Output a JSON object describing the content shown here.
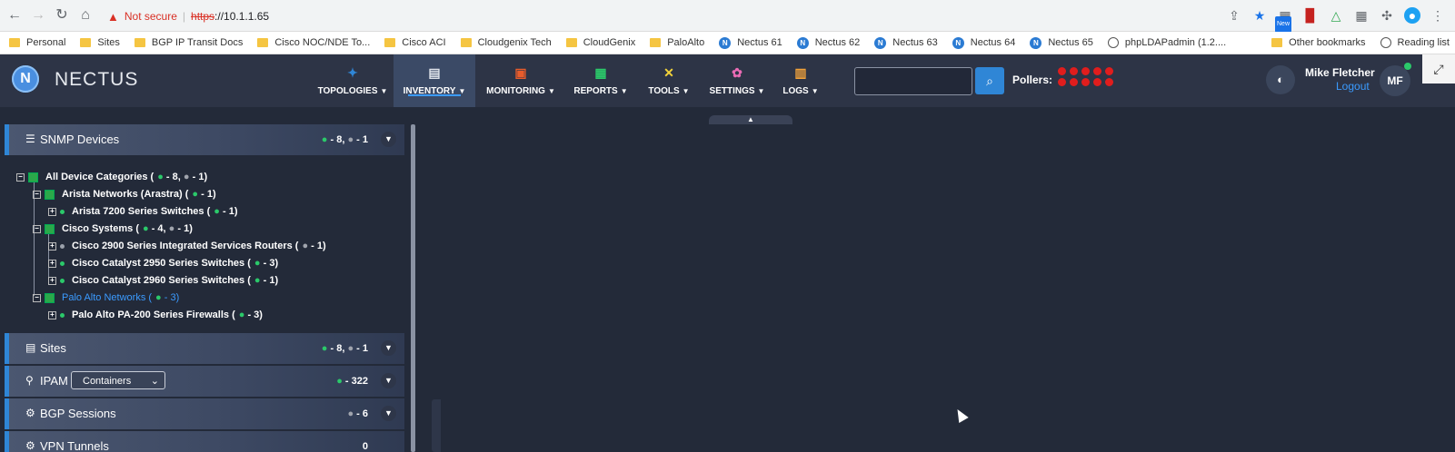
{
  "browser": {
    "security": "Not secure",
    "url_scheme": "https",
    "url_rest": "://10.1.1.65",
    "badge_new": "New"
  },
  "bookmarks": [
    {
      "label": "Personal",
      "icon": "folder"
    },
    {
      "label": "Sites",
      "icon": "folder"
    },
    {
      "label": "BGP IP Transit Docs",
      "icon": "folder"
    },
    {
      "label": "Cisco NOC/NDE To...",
      "icon": "folder"
    },
    {
      "label": "Cisco ACI",
      "icon": "folder"
    },
    {
      "label": "Cloudgenix Tech",
      "icon": "folder"
    },
    {
      "label": "CloudGenix",
      "icon": "folder"
    },
    {
      "label": "PaloAlto",
      "icon": "folder"
    },
    {
      "label": "Nectus 61",
      "icon": "nectus"
    },
    {
      "label": "Nectus 62",
      "icon": "nectus"
    },
    {
      "label": "Nectus 63",
      "icon": "nectus"
    },
    {
      "label": "Nectus 64",
      "icon": "nectus"
    },
    {
      "label": "Nectus 65",
      "icon": "nectus"
    },
    {
      "label": "phpLDAPadmin (1.2....",
      "icon": "globe"
    }
  ],
  "bookmarks_right": {
    "other": "Other bookmarks",
    "reading": "Reading list"
  },
  "app": {
    "logo": "NECTUS",
    "logo_mark": "N",
    "menu": [
      {
        "label": "TOPOLOGIES",
        "icon": "topology-icon"
      },
      {
        "label": "INVENTORY",
        "icon": "inventory-icon"
      },
      {
        "label": "MONITORING",
        "icon": "monitoring-icon"
      },
      {
        "label": "REPORTS",
        "icon": "reports-icon"
      },
      {
        "label": "TOOLS",
        "icon": "tools-icon"
      },
      {
        "label": "SETTINGS",
        "icon": "settings-icon"
      },
      {
        "label": "LOGS",
        "icon": "logs-icon"
      }
    ],
    "search_placeholder": "",
    "pollers_label": "Pollers:",
    "user_name": "Mike Fletcher",
    "logout": "Logout",
    "avatar_initials": "MF"
  },
  "panel": {
    "snmp": {
      "title": "SNMP Devices",
      "up": "8",
      "down": "1"
    },
    "tree": [
      {
        "label": "All Device Categories (",
        "up": "8",
        "down": "1"
      },
      {
        "label": "Arista Networks (Arastra) (",
        "up": "1"
      },
      {
        "label": "Arista 7200 Series Switches (",
        "up": "1"
      },
      {
        "label": "Cisco Systems (",
        "up": "4",
        "down": "1"
      },
      {
        "label": "Cisco 2900 Series Integrated Services Routers (",
        "down": "1"
      },
      {
        "label": "Cisco Catalyst 2950 Series Switches (",
        "up": "3"
      },
      {
        "label": "Cisco Catalyst 2960 Series Switches (",
        "up": "1"
      },
      {
        "label": "Palo Alto Networks (",
        "up": "3"
      },
      {
        "label": "Palo Alto PA-200 Series Firewalls (",
        "up": "3"
      }
    ],
    "sites": {
      "title": "Sites",
      "up": "8",
      "down": "1"
    },
    "ipam": {
      "title": "IPAM",
      "select": "Containers",
      "count": "322"
    },
    "bgp": {
      "title": "BGP Sessions",
      "count": "6"
    },
    "vpn": {
      "title": "VPN Tunnels",
      "count": "0"
    }
  }
}
